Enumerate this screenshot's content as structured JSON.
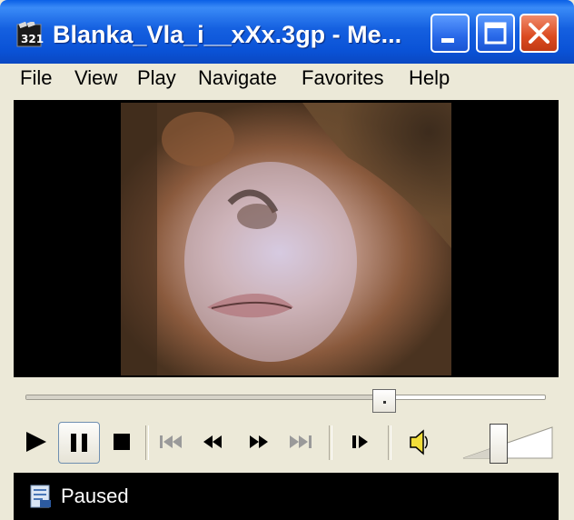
{
  "window": {
    "title": "Blanka_Vla_i__xXx.3gp - Me...",
    "app_icon": "media-player-classic-icon",
    "title_buttons": [
      "minimize-icon",
      "maximize-icon",
      "close-icon"
    ]
  },
  "menubar": {
    "items": [
      "File",
      "View",
      "Play",
      "Navigate",
      "Favorites",
      "Help"
    ]
  },
  "video": {
    "description_icon": "video-frame"
  },
  "seekbar": {
    "position": 0.69
  },
  "controls": {
    "buttons": [
      "play-icon",
      "pause-icon",
      "stop-icon",
      "skip-back-icon",
      "rewind-icon",
      "fast-forward-icon",
      "skip-forward-icon",
      "frame-step-icon",
      "speaker-icon"
    ],
    "active": "pause-icon"
  },
  "volume": {
    "level": 0.4
  },
  "status": {
    "icon": "status-file-icon",
    "text": "Paused"
  },
  "colors": {
    "title_bar": "#0a52d6",
    "close_button": "#db4a20",
    "window_face": "#ece9d8",
    "video_background": "#000000",
    "status_background": "#000000"
  }
}
